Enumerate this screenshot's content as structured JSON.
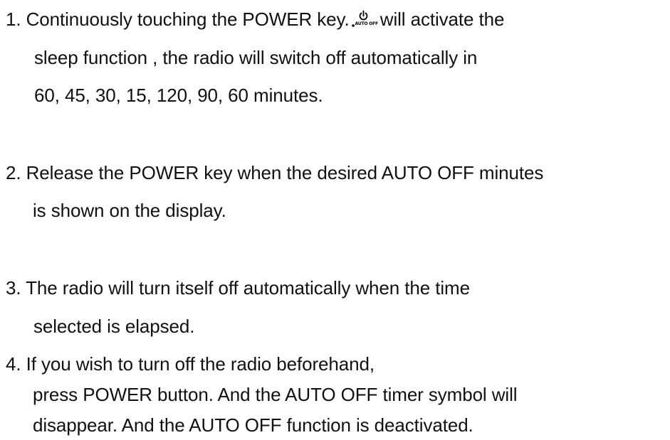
{
  "items": [
    {
      "lines": [
        "1. Continuously touching the POWER key.",
        "will activate the",
        "sleep function , the radio will switch off automatically in",
        "60, 45, 30, 15, 120, 90, 60 minutes."
      ],
      "icon": "power-auto-off-icon",
      "icon_label": "AUTO OFF"
    },
    {
      "lines": [
        "2. Release the POWER key when the desired AUTO OFF minutes",
        "is shown on the display."
      ]
    },
    {
      "lines": [
        "3. The radio will turn itself off automatically when the time",
        "selected is elapsed."
      ]
    },
    {
      "lines": [
        "4. If you wish to turn off the radio beforehand,",
        "press POWER button. And the AUTO OFF timer symbol will",
        "disappear. And the AUTO OFF function is deactivated."
      ]
    }
  ]
}
